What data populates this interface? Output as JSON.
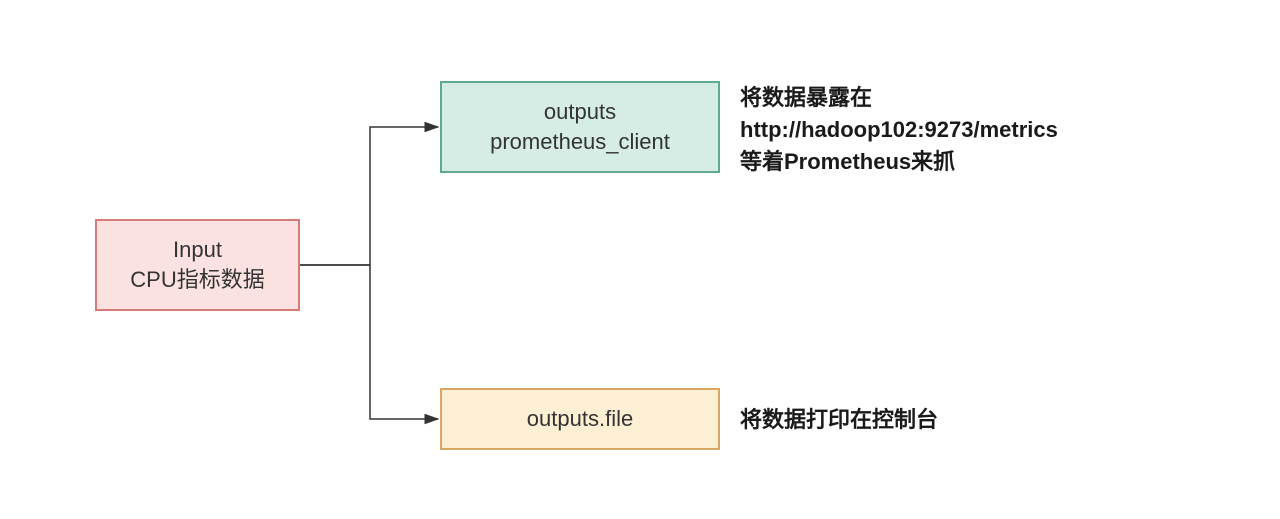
{
  "diagram": {
    "nodes": {
      "input": {
        "line1": "Input",
        "line2": "CPU指标数据"
      },
      "output_prometheus": {
        "line1": "outputs",
        "line2": "prometheus_client"
      },
      "output_file": {
        "line1": "outputs.file"
      }
    },
    "annotations": {
      "prometheus": {
        "line1": "将数据暴露在",
        "line2": "http://hadoop102:9273/metrics",
        "line3": "等着Prometheus来抓"
      },
      "file": {
        "line1": "将数据打印在控制台"
      }
    },
    "colors": {
      "input_fill": "#fbe2e1",
      "input_border": "#d77a7a",
      "prom_fill": "#d6ede6",
      "prom_border": "#5ea894",
      "file_fill": "#fdefd4",
      "file_border": "#d8a860"
    }
  }
}
